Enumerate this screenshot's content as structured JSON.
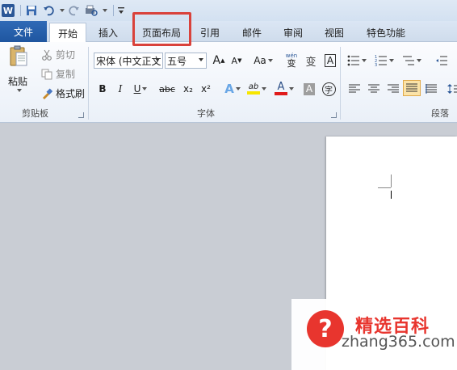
{
  "quick_access": {
    "app_letter": "W",
    "icons": [
      "save-icon",
      "undo-icon",
      "redo-icon",
      "print-preview-icon",
      "customize-icon"
    ]
  },
  "tabs": {
    "file": "文件",
    "home": "开始",
    "insert": "插入",
    "page_layout": "页面布局",
    "references": "引用",
    "mailings": "邮件",
    "review": "审阅",
    "view": "视图",
    "special": "特色功能"
  },
  "clipboard": {
    "paste": "粘贴",
    "cut": "剪切",
    "copy": "复制",
    "format_painter": "格式刷",
    "group_label": "剪贴板"
  },
  "font": {
    "font_name": "宋体 (中文正文",
    "font_size": "五号",
    "grow": "A",
    "shrink": "A",
    "change_case": "Aa",
    "bold": "B",
    "italic": "I",
    "underline": "U",
    "strikethrough": "abc",
    "subscript": "x₂",
    "superscript": "x²",
    "text_effects": "A",
    "highlight": "ab",
    "font_color": "A",
    "char_shading": "A",
    "enclose": "字",
    "phonetic": "wén",
    "phonetic_char": "变",
    "border_char": "A",
    "group_label": "字体",
    "colors": {
      "highlight": "#f7e600",
      "font_color": "#e01b1b"
    }
  },
  "paragraph": {
    "group_label": "段落"
  },
  "watermark": {
    "symbol": "?",
    "title": "精选百科",
    "url": "zhang365.com",
    "color": "#e8352e"
  }
}
